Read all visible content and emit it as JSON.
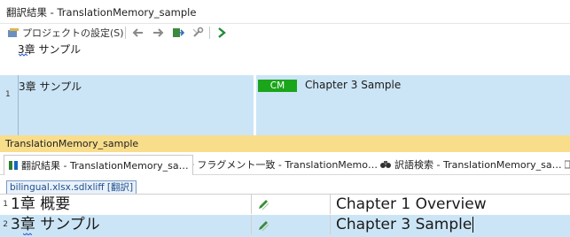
{
  "window": {
    "title": "翻訳結果 - TranslationMemory_sample"
  },
  "toolbar": {
    "project_settings_label": "プロジェクトの設定(S)"
  },
  "source_preview": {
    "text": "3章 サンプル"
  },
  "tm_match": {
    "row_number": "1",
    "source": "3章 サンプル",
    "badge": "CM",
    "target": "Chapter 3 Sample",
    "badge_color": "#1aa51a"
  },
  "tm_name_strip": {
    "text": "TranslationMemory_sample"
  },
  "bottom_tabs": [
    {
      "label": "翻訳結果 - TranslationMemory_sa…"
    },
    {
      "label": "フラグメント一致 - TranslationMemo…"
    },
    {
      "label": "訳語検索 - TranslationMemory_sa…"
    }
  ],
  "document_tab": {
    "label": "bilingual.xlsx.sdlxliff [翻訳]"
  },
  "editor_rows": [
    {
      "number": "1",
      "source": "1章 概要",
      "target": "Chapter 1 Overview"
    },
    {
      "number": "2",
      "source": "3章 サンプル",
      "target": "Chapter 3 Sample"
    }
  ],
  "colors": {
    "selection": "#cce5f6",
    "tm_strip": "#f8dd8b"
  }
}
